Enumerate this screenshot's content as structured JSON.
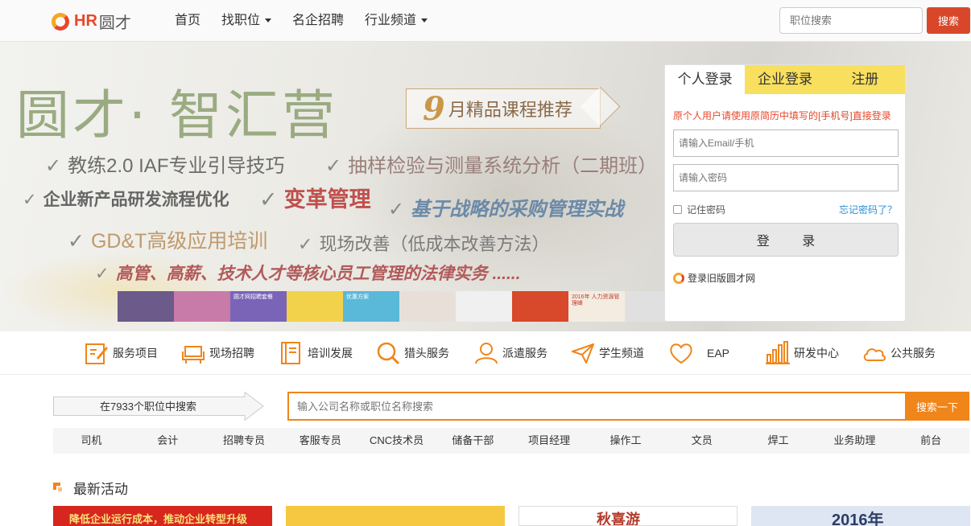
{
  "logo": {
    "brand": "HR",
    "brand_cn": "圆才"
  },
  "nav": {
    "items": [
      {
        "label": "首页",
        "dropdown": false
      },
      {
        "label": "找职位",
        "dropdown": true
      },
      {
        "label": "名企招聘",
        "dropdown": false
      },
      {
        "label": "行业频道",
        "dropdown": true
      }
    ]
  },
  "top_search": {
    "placeholder": "职位搜索",
    "button": "搜索"
  },
  "banner": {
    "title": "圆才· 智汇营",
    "badge_num": "9",
    "badge_text": "月精品课程推荐",
    "courses": [
      "教练2.0 IAF专业引导技巧",
      "抽样检验与测量系统分析（二期班）",
      "企业新产品研发流程优化",
      "变革管理",
      "基于战略的采购管理实战",
      "GD&T高级应用培训",
      "现场改善（低成本改善方法）",
      "高管、高薪、技术人才等核心员工管理的法律实务 ......"
    ],
    "check": "✓",
    "thumbs": [
      {
        "text": "",
        "color": "#6b5a8a"
      },
      {
        "text": "",
        "color": "#c87aa8"
      },
      {
        "text": "圆才网招聘套餐",
        "color": "#7a64b8"
      },
      {
        "text": "",
        "color": "#f2d24a"
      },
      {
        "text": "优惠方案",
        "color": "#5ab8d8"
      },
      {
        "text": "",
        "color": "#e8e0d8"
      },
      {
        "text": "",
        "color": "#f0f0f0"
      },
      {
        "text": "",
        "color": "#d8482a"
      },
      {
        "text": "2016年 人力资源管理峰",
        "color": "#f4ece0"
      },
      {
        "text": "",
        "color": "#e0e0e0"
      }
    ]
  },
  "login": {
    "tabs": [
      "个人登录",
      "企业登录",
      "注册"
    ],
    "note_pre": "原个人用户请使用原简历中填写的",
    "note_em": "[手机号]",
    "note_post": "直接登录",
    "email_placeholder": "请输入Email/手机",
    "password_placeholder": "请输入密码",
    "remember": "记住密码",
    "forgot": "忘记密码了？",
    "submit": "登 录",
    "old_site": "登录旧版圆才网"
  },
  "services": [
    {
      "label": "服务项目",
      "icon": "edit-icon"
    },
    {
      "label": "现场招聘",
      "icon": "chair-icon"
    },
    {
      "label": "培训发展",
      "icon": "book-icon"
    },
    {
      "label": "猎头服务",
      "icon": "search-icon"
    },
    {
      "label": "派遣服务",
      "icon": "user-icon"
    },
    {
      "label": "学生频道",
      "icon": "paper-plane-icon"
    },
    {
      "label": "EAP",
      "icon": "heart-icon"
    },
    {
      "label": "研发中心",
      "icon": "bar-chart-icon"
    },
    {
      "label": "公共服务",
      "icon": "cloud-icon"
    }
  ],
  "job_search": {
    "count_text": "在7933个职位中搜索",
    "placeholder": "输入公司名称或职位名称搜索",
    "button": "搜索一下"
  },
  "hot_jobs": [
    "司机",
    "会计",
    "招聘专员",
    "客服专员",
    "CNC技术员",
    "储备干部",
    "项目经理",
    "操作工",
    "文员",
    "焊工",
    "业务助理",
    "前台"
  ],
  "activities": {
    "title": "最新活动",
    "items": [
      {
        "text": "降低企业运行成本，推动企业转型升级",
        "bg": "#d7261e",
        "color": "#fbe27a"
      },
      {
        "text": "",
        "bg": "#f6c842",
        "color": "#ffffff"
      },
      {
        "text": "秋喜游",
        "bg": "#ffffff",
        "color": "#b33a2a"
      },
      {
        "text": "2016年",
        "bg": "#dfe6f3",
        "color": "#2c3e66"
      }
    ]
  },
  "colors": {
    "brand_red": "#d9472b",
    "brand_orange": "#f08519",
    "tab_yellow": "#f8df5e"
  }
}
